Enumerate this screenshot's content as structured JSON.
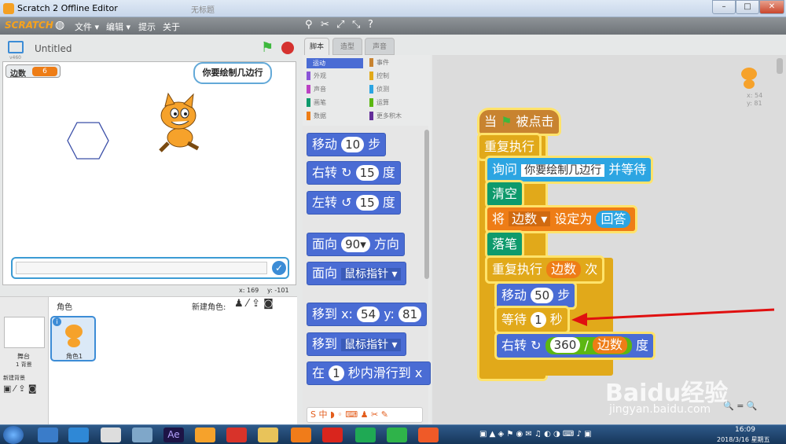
{
  "window": {
    "title": "Scratch 2 Offline Editor",
    "tab_faint": "无标题"
  },
  "menu": {
    "logo": "SCRATCH",
    "items": [
      "文件 ▾",
      "编辑 ▾",
      "提示",
      "关于"
    ]
  },
  "stage": {
    "project_title": "Untitled",
    "version": "v460",
    "var_label": "边数",
    "var_value": "6",
    "speech": "你要绘制几边行",
    "coords_x": "x: 169",
    "coords_y": "y: -101"
  },
  "tabs": [
    "脚本",
    "造型",
    "声音"
  ],
  "categories_left": [
    "运动",
    "外观",
    "声音",
    "画笔",
    "数据"
  ],
  "categories_right": [
    "事件",
    "控制",
    "侦测",
    "运算",
    "更多积木"
  ],
  "palette": {
    "move": [
      "移动",
      "10",
      "步"
    ],
    "turn_right": [
      "右转",
      "15",
      "度"
    ],
    "turn_left": [
      "左转",
      "15",
      "度"
    ],
    "point_dir": [
      "面向",
      "90▾",
      "方向"
    ],
    "point_toward": [
      "面向",
      "鼠标指针 ▾"
    ],
    "goto_xy": [
      "移到 x:",
      "54",
      "y:",
      "81"
    ],
    "goto": [
      "移到",
      "鼠标指针 ▾"
    ],
    "glide": [
      "在",
      "1",
      "秒内滑行到 x"
    ]
  },
  "sprites": {
    "header": "角色",
    "new_sprite": "新建角色:",
    "stage_label": "舞台",
    "stage_sub": "1 背景",
    "new_bg": "新建背景",
    "sprite1": "角色1"
  },
  "script": {
    "hat": [
      "当",
      "被点击"
    ],
    "forever": "重复执行",
    "ask": [
      "询问",
      "你要绘制几边行",
      "并等待"
    ],
    "clear": "清空",
    "set": [
      "将",
      "边数 ▾",
      "设定为",
      "回答"
    ],
    "pen_down": "落笔",
    "repeat": [
      "重复执行",
      "边数",
      "次"
    ],
    "move": [
      "移动",
      "50",
      "步"
    ],
    "wait": [
      "等待",
      "1",
      "秒"
    ],
    "turn": [
      "右转",
      "360",
      "/",
      "边数",
      "度"
    ],
    "sprite_x": "x: 54",
    "sprite_y": "y: 81"
  },
  "watermark": {
    "brand": "Baidu经验",
    "url": "jingyan.baidu.com"
  },
  "taskbar": {
    "time": "16:09",
    "date": "2018/3/16 星期五"
  },
  "colors": {
    "motion": "#4a6cd4",
    "looks": "#8a55d7",
    "sound": "#bb42c3",
    "pen": "#0e9a6c",
    "data": "#ee7d16",
    "events": "#c88330",
    "control": "#e1a91a",
    "operators": "#5cb712",
    "arrow": "#e01010"
  }
}
